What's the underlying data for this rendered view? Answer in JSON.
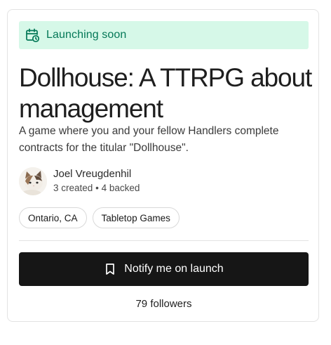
{
  "banner": {
    "label": "Launching soon",
    "icon": "calendar-clock-icon",
    "color": "#047857",
    "background": "#d6f8e8"
  },
  "project": {
    "title": "Dollhouse: A TTRPG about management",
    "description": "A game where you and your fellow Handlers complete contracts for the titular \"Dollhouse\"."
  },
  "creator": {
    "name": "Joel Vreugdenhil",
    "created": "3 created",
    "separator": "•",
    "backed": "4 backed",
    "avatar": "cat-avatar"
  },
  "tags": [
    "Ontario, CA",
    "Tabletop Games"
  ],
  "notify_button": {
    "label": "Notify me on launch",
    "icon": "bookmark-icon",
    "background": "#161616"
  },
  "followers": "79 followers"
}
